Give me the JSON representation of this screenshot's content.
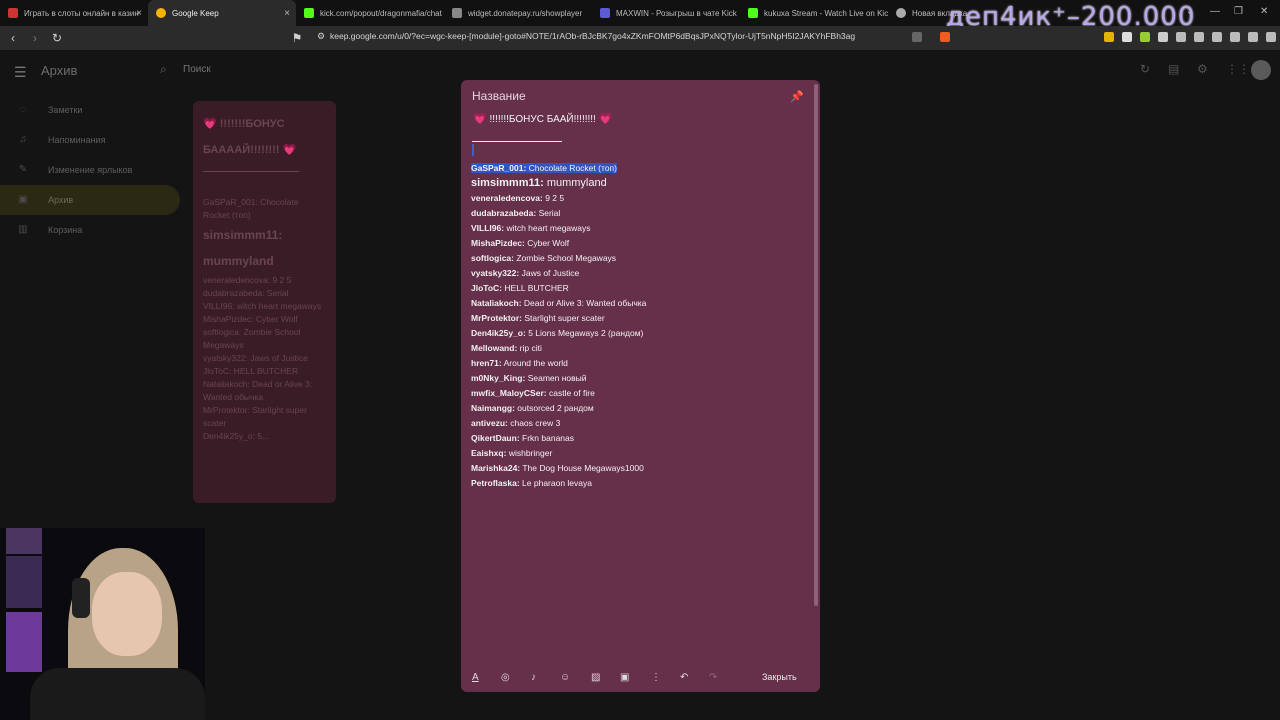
{
  "browser": {
    "tabs": [
      {
        "label": "Играть в слоты онлайн в казин",
        "color": "#cc3333"
      },
      {
        "label": "Google Keep",
        "color": "#f4b400",
        "active": true
      },
      {
        "label": "kick.com/popout/dragonmafia/chat",
        "color": "#53fc18"
      },
      {
        "label": "widget.donatepay.ru/showplayer",
        "color": "#888888"
      },
      {
        "label": "MAXWIN - Розыгрыш в чате Kick",
        "color": "#5b5bd6"
      },
      {
        "label": "kukuxa Stream - Watch Live on Kick",
        "color": "#53fc18"
      },
      {
        "label": "Новая вкладка",
        "color": "#aaaaaa"
      }
    ],
    "url": "keep.google.com/u/0/?ec=wgc-keep-[module]-goto#NOTE/1rAOb-rBJcBK7go4xZKmFOMtP6dBqsJPxNQTylor-UjT5nNpH5I2JAKYhFBh3ag",
    "overlay": "деп4ик⁺–200.000"
  },
  "keep": {
    "title": "Архив",
    "search_placeholder": "Поиск",
    "sidebar": [
      {
        "label": "Заметки",
        "icon": "lightbulb-icon"
      },
      {
        "label": "Напоминания",
        "icon": "bell-icon"
      },
      {
        "label": "Изменение ярлыков",
        "icon": "pencil-icon"
      },
      {
        "label": "Архив",
        "icon": "archive-icon",
        "active": true
      },
      {
        "label": "Корзина",
        "icon": "trash-icon"
      }
    ],
    "bg_card": {
      "heading": "💗 !!!!!!!БОНУС БААААЙ!!!!!!!! 💗",
      "rows": [
        "GaSPaR_001: Chocolate Rocket (топ)",
        "simsimmm11: mummyland",
        "veneraledencova: 9 2 5",
        "dudabrazabeda: Serial",
        "VILLI96: witch heart megaways",
        "MishaPizdec: Cyber Wolf",
        "softlogica: Zombie School Megaways",
        "vyatsky322: Jaws of Justice",
        "JloToC: HELL BUTCHER",
        "Nataliakoch: Dead or Alive 3: Wanted обычка",
        "MrProtektor: Starlight super scater",
        "Den4ik25y_o: 5..."
      ]
    }
  },
  "note": {
    "title_placeholder": "Название",
    "heading": "!!!!!!!БОНУС БААЙ!!!!!!!!",
    "heart": "💗",
    "entries": [
      {
        "user": "GaSPaR_001:",
        "game": "Chocolate Rocket (топ)"
      },
      {
        "user": "simsimmm11:",
        "game": "mummyland"
      },
      {
        "user": "veneraledencova:",
        "game": "9 2 5"
      },
      {
        "user": "dudabrazabeda:",
        "game": "Serial"
      },
      {
        "user": "VILLI96:",
        "game": "witch heart megaways"
      },
      {
        "user": "MishaPizdec:",
        "game": "Cyber Wolf"
      },
      {
        "user": "softlogica:",
        "game": "Zombie School Megaways"
      },
      {
        "user": "vyatsky322:",
        "game": "Jaws of Justice"
      },
      {
        "user": "JloToC:",
        "game": "HELL BUTCHER"
      },
      {
        "user": "Nataliakoch:",
        "game": "Dead or Alive 3: Wanted обычка"
      },
      {
        "user": "MrProtektor:",
        "game": "Starlight super scater"
      },
      {
        "user": "Den4ik25y_o:",
        "game": "5 Lions Megaways 2 (рандом)"
      },
      {
        "user": "Mellowand:",
        "game": "rip citi"
      },
      {
        "user": "hren71:",
        "game": "Around the world"
      },
      {
        "user": "m0Nky_King:",
        "game": "Seamen новый"
      },
      {
        "user": "mwfix_MaloyCSer:",
        "game": "castle of fire"
      },
      {
        "user": "Naimangg:",
        "game": "outsorced 2 рандом"
      },
      {
        "user": "antivezu:",
        "game": "chaos crew 3"
      },
      {
        "user": "QikertDaun:",
        "game": "Frkn bananas"
      },
      {
        "user": "Eaishxq:",
        "game": "wishbringer"
      },
      {
        "user": "Marishka24:",
        "game": "The Dog House Megaways1000"
      },
      {
        "user": "Petroflaska:",
        "game": "Le pharaon levaya"
      }
    ],
    "close_label": "Закрыть"
  }
}
